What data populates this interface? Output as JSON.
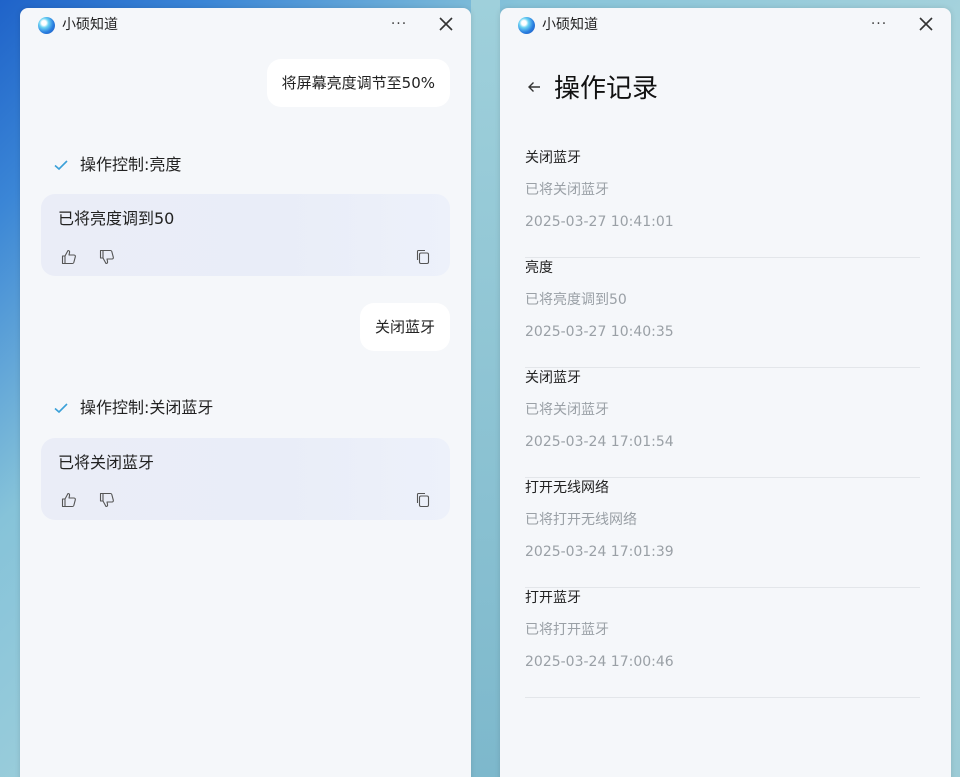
{
  "app": {
    "title": "小硕知道",
    "more_label": "···"
  },
  "chat": {
    "messages": [
      {
        "user": "将屏幕亮度调节至50%",
        "status": "操作控制:亮度",
        "reply": "已将亮度调到50"
      },
      {
        "user": "关闭蓝牙",
        "status": "操作控制:关闭蓝牙",
        "reply": "已将关闭蓝牙"
      }
    ]
  },
  "log": {
    "title": "操作记录",
    "items": [
      {
        "title": "关闭蓝牙",
        "desc": "已将关闭蓝牙",
        "time": "2025-03-27 10:41:01"
      },
      {
        "title": "亮度",
        "desc": "已将亮度调到50",
        "time": "2025-03-27 10:40:35"
      },
      {
        "title": "关闭蓝牙",
        "desc": "已将关闭蓝牙",
        "time": "2025-03-24 17:01:54"
      },
      {
        "title": "打开无线网络",
        "desc": "已将打开无线网络",
        "time": "2025-03-24 17:01:39"
      },
      {
        "title": "打开蓝牙",
        "desc": "已将打开蓝牙",
        "time": "2025-03-24 17:00:46"
      }
    ]
  },
  "colors": {
    "accent_check": "#3aa0d8",
    "window_bg": "#f5f7fa",
    "card_bg": "#eaedf7"
  }
}
